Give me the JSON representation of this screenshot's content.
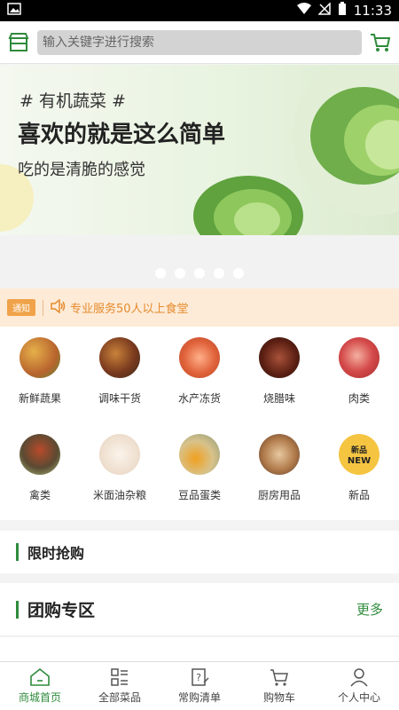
{
  "status_bar": {
    "time": "11:33"
  },
  "header": {
    "search_placeholder": "输入关键字进行搜索",
    "icons": [
      "store-icon",
      "cart-icon"
    ]
  },
  "banner": {
    "tag": "# 有机蔬菜 #",
    "title": "喜欢的就是这么简单",
    "subtitle": "吃的是清脆的感觉",
    "slide_count": 5
  },
  "notice": {
    "badge": "通知",
    "text": "专业服务50人以上食堂"
  },
  "categories": [
    {
      "label": "新鲜蔬果",
      "color": "#c9763a"
    },
    {
      "label": "调味干货",
      "color": "#8b4a2a"
    },
    {
      "label": "水产冻货",
      "color": "#e0623a"
    },
    {
      "label": "烧腊味",
      "color": "#6a2a1a"
    },
    {
      "label": "肉类",
      "color": "#d44a4a"
    },
    {
      "label": "禽类",
      "color": "#6b5a3a"
    },
    {
      "label": "米面油杂粮",
      "color": "#efe0d0"
    },
    {
      "label": "豆品蛋类",
      "color": "#d8c28a"
    },
    {
      "label": "厨房用品",
      "color": "#b07a4a"
    },
    {
      "label": "新品",
      "color": "#f5c542"
    }
  ],
  "sections": {
    "flash_sale": "限时抢购",
    "group_buy": "团购专区",
    "more": "更多"
  },
  "tabs": [
    {
      "label": "商城首页",
      "icon": "home-icon",
      "active": true
    },
    {
      "label": "全部菜品",
      "icon": "category-icon",
      "active": false
    },
    {
      "label": "常购清单",
      "icon": "list-icon",
      "active": false
    },
    {
      "label": "购物车",
      "icon": "cart-icon",
      "active": false
    },
    {
      "label": "个人中心",
      "icon": "user-icon",
      "active": false
    }
  ],
  "colors": {
    "accent": "#2f8b3c",
    "notice_text": "#e68a2e",
    "notice_bg": "#fdebd7"
  }
}
